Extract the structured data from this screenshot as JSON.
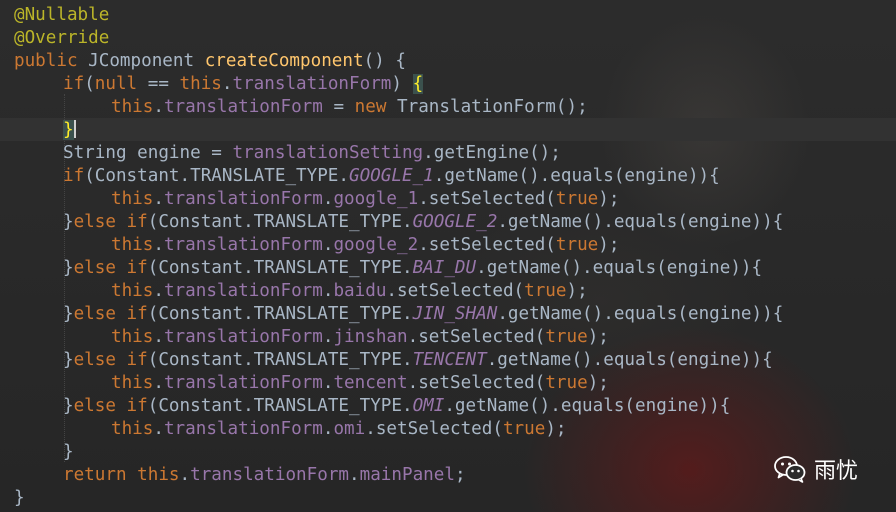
{
  "editor": {
    "lines": [
      [
        {
          "t": "@Nullable",
          "c": "ann"
        }
      ],
      [
        {
          "t": "@Override",
          "c": "ann"
        }
      ],
      [
        {
          "t": "public ",
          "c": "kw"
        },
        {
          "t": "JComponent "
        },
        {
          "t": "createComponent",
          "c": "fn"
        },
        {
          "t": "() {"
        }
      ],
      [
        {
          "t": "if",
          "c": "kw"
        },
        {
          "t": "("
        },
        {
          "t": "null ",
          "c": "kw"
        },
        {
          "t": "== "
        },
        {
          "t": "this",
          "c": "kw"
        },
        {
          "t": "."
        },
        {
          "t": "translationForm",
          "c": "fld"
        },
        {
          "t": ") "
        },
        {
          "t": "{",
          "c": "brace"
        }
      ],
      [
        {
          "t": "this",
          "c": "kw"
        },
        {
          "t": "."
        },
        {
          "t": "translationForm",
          "c": "fld"
        },
        {
          "t": " = "
        },
        {
          "t": "new ",
          "c": "kw"
        },
        {
          "t": "TranslationForm();"
        }
      ],
      [
        {
          "t": "}",
          "c": "brace"
        },
        {
          "t": "",
          "c": "caret"
        }
      ],
      [
        {
          "t": "String engine = "
        },
        {
          "t": "translationSetting",
          "c": "fld"
        },
        {
          "t": ".getEngine();"
        }
      ],
      [
        {
          "t": "if",
          "c": "kw"
        },
        {
          "t": "(Constant.TRANSLATE_TYPE."
        },
        {
          "t": "GOOGLE_1",
          "c": "sta"
        },
        {
          "t": ".getName().equals(engine)){"
        }
      ],
      [
        {
          "t": "this",
          "c": "kw"
        },
        {
          "t": "."
        },
        {
          "t": "translationForm",
          "c": "fld"
        },
        {
          "t": "."
        },
        {
          "t": "google_1",
          "c": "fld"
        },
        {
          "t": ".setSelected("
        },
        {
          "t": "true",
          "c": "kw"
        },
        {
          "t": ");"
        }
      ],
      [
        {
          "t": "}"
        },
        {
          "t": "else if",
          "c": "kw"
        },
        {
          "t": "(Constant.TRANSLATE_TYPE."
        },
        {
          "t": "GOOGLE_2",
          "c": "sta"
        },
        {
          "t": ".getName().equals(engine)){"
        }
      ],
      [
        {
          "t": "this",
          "c": "kw"
        },
        {
          "t": "."
        },
        {
          "t": "translationForm",
          "c": "fld"
        },
        {
          "t": "."
        },
        {
          "t": "google_2",
          "c": "fld"
        },
        {
          "t": ".setSelected("
        },
        {
          "t": "true",
          "c": "kw"
        },
        {
          "t": ");"
        }
      ],
      [
        {
          "t": "}"
        },
        {
          "t": "else if",
          "c": "kw"
        },
        {
          "t": "(Constant.TRANSLATE_TYPE."
        },
        {
          "t": "BAI_DU",
          "c": "sta"
        },
        {
          "t": ".getName().equals(engine)){"
        }
      ],
      [
        {
          "t": "this",
          "c": "kw"
        },
        {
          "t": "."
        },
        {
          "t": "translationForm",
          "c": "fld"
        },
        {
          "t": "."
        },
        {
          "t": "baidu",
          "c": "fld"
        },
        {
          "t": ".setSelected("
        },
        {
          "t": "true",
          "c": "kw"
        },
        {
          "t": ");"
        }
      ],
      [
        {
          "t": "}"
        },
        {
          "t": "else if",
          "c": "kw"
        },
        {
          "t": "(Constant.TRANSLATE_TYPE."
        },
        {
          "t": "JIN_SHAN",
          "c": "sta"
        },
        {
          "t": ".getName().equals(engine)){"
        }
      ],
      [
        {
          "t": "this",
          "c": "kw"
        },
        {
          "t": "."
        },
        {
          "t": "translationForm",
          "c": "fld"
        },
        {
          "t": "."
        },
        {
          "t": "jinshan",
          "c": "fld"
        },
        {
          "t": ".setSelected("
        },
        {
          "t": "true",
          "c": "kw"
        },
        {
          "t": ");"
        }
      ],
      [
        {
          "t": "}"
        },
        {
          "t": "else if",
          "c": "kw"
        },
        {
          "t": "(Constant.TRANSLATE_TYPE."
        },
        {
          "t": "TENCENT",
          "c": "sta"
        },
        {
          "t": ".getName().equals(engine)){"
        }
      ],
      [
        {
          "t": "this",
          "c": "kw"
        },
        {
          "t": "."
        },
        {
          "t": "translationForm",
          "c": "fld"
        },
        {
          "t": "."
        },
        {
          "t": "tencent",
          "c": "fld"
        },
        {
          "t": ".setSelected("
        },
        {
          "t": "true",
          "c": "kw"
        },
        {
          "t": ");"
        }
      ],
      [
        {
          "t": "}"
        },
        {
          "t": "else if",
          "c": "kw"
        },
        {
          "t": "(Constant.TRANSLATE_TYPE."
        },
        {
          "t": "OMI",
          "c": "sta"
        },
        {
          "t": ".getName().equals(engine)){"
        }
      ],
      [
        {
          "t": "this",
          "c": "kw"
        },
        {
          "t": "."
        },
        {
          "t": "translationForm",
          "c": "fld"
        },
        {
          "t": "."
        },
        {
          "t": "omi",
          "c": "fld"
        },
        {
          "t": ".setSelected("
        },
        {
          "t": "true",
          "c": "kw"
        },
        {
          "t": ");"
        }
      ],
      [
        {
          "t": "}"
        }
      ],
      [
        {
          "t": "return ",
          "c": "kw"
        },
        {
          "t": "this",
          "c": "kw"
        },
        {
          "t": "."
        },
        {
          "t": "translationForm",
          "c": "fld"
        },
        {
          "t": "."
        },
        {
          "t": "mainPanel",
          "c": "fld"
        },
        {
          "t": ";"
        }
      ],
      [
        {
          "t": "}"
        }
      ]
    ]
  },
  "colors": {
    "background": "#2b2b2b",
    "keyword": "#cc7832",
    "annotation": "#bbb529",
    "method": "#ffc66d",
    "field": "#9876aa",
    "text": "#a9b7c6"
  },
  "watermark": {
    "icon": "wechat-icon",
    "label": "雨忧"
  }
}
